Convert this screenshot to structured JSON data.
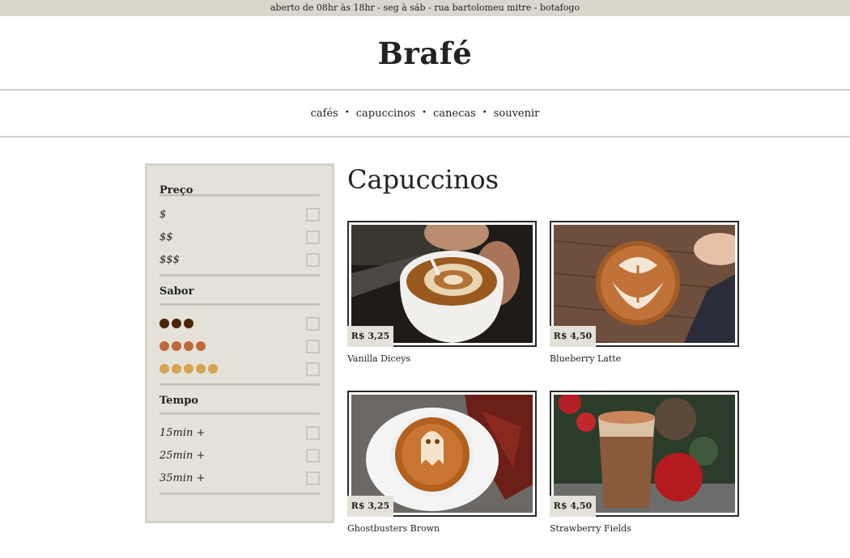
{
  "topbar": {
    "text": "aberto de 08hr às 18hr - seg à sáb - rua bartolomeu mitre - botafogo"
  },
  "brand": {
    "name": "Brafé"
  },
  "nav": {
    "items": [
      "cafés",
      "capuccinos",
      "canecas",
      "souvenir"
    ]
  },
  "filters": {
    "price": {
      "title": "Preço",
      "options": [
        "$",
        "$$",
        "$$$"
      ]
    },
    "flavor": {
      "title": "Sabor",
      "options": [
        {
          "dots": 3,
          "color": "#4a2608"
        },
        {
          "dots": 4,
          "color": "#c0673b"
        },
        {
          "dots": 5,
          "color": "#d4a552"
        }
      ]
    },
    "time": {
      "title": "Tempo",
      "options": [
        "15min +",
        "25min +",
        "35min +"
      ]
    }
  },
  "main": {
    "title": "Capuccinos",
    "products": [
      {
        "name": "Vanilla Diceys",
        "price": "R$ 3,25"
      },
      {
        "name": "Blueberry Latte",
        "price": "R$ 4,50"
      },
      {
        "name": "Ghostbusters Brown",
        "price": "R$ 3,25"
      },
      {
        "name": "Strawberry Fields",
        "price": "R$ 4,50"
      }
    ]
  }
}
